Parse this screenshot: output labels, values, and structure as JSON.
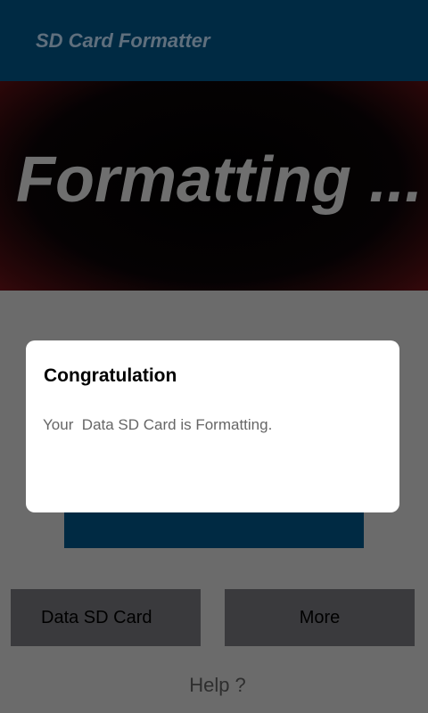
{
  "app_bar": {
    "title": "SD Card Formatter"
  },
  "banner": {
    "text": "Formatting ..."
  },
  "buttons": {
    "data_sd_card": "Data SD Card",
    "more": "More"
  },
  "help": {
    "label": "Help ?"
  },
  "dialog": {
    "title": "Congratulation",
    "message": "Your  Data SD Card is Formatting."
  },
  "colors": {
    "app_bar": "#002a43",
    "dimmed_background": "#6b6b6b",
    "dialog_background": "#ffffff"
  }
}
